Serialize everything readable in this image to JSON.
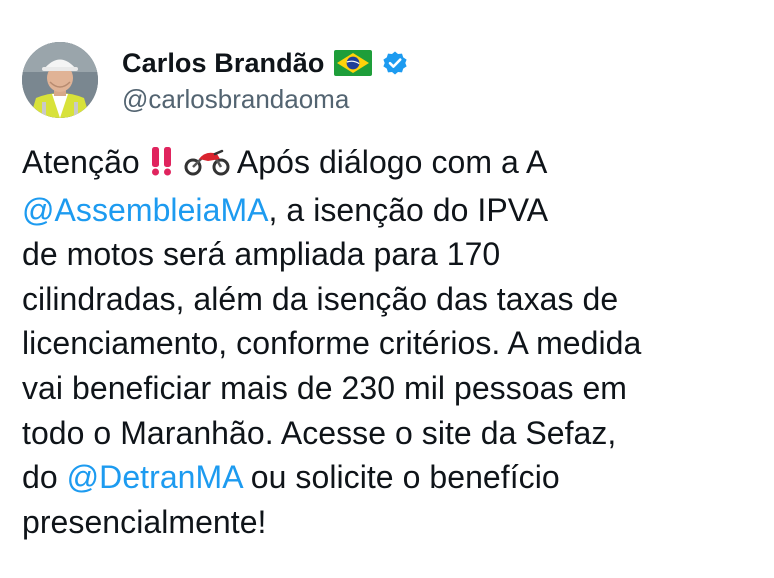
{
  "author": {
    "display_name": "Carlos Brandão",
    "handle": "@carlosbrandaoma",
    "flag_icon": "brazil-flag-icon",
    "verified_icon": "verified-badge-icon",
    "verified_color": "#1d9bf0"
  },
  "tweet": {
    "line1_a": "Atenção",
    "line1_icons": [
      "double-exclamation-icon",
      "motorcycle-icon"
    ],
    "line1_b": "Após diálogo com a A",
    "mention_assembleia": "@AssembleiaMA",
    "line2_rest": ", a isenção do IPVA",
    "line3": "de motos será ampliada para 170",
    "line4": "cilindradas, além da isenção das taxas de",
    "line5": "licenciamento, conforme critérios. A medida",
    "line6": "vai beneficiar mais de 230 mil pessoas em",
    "line7": "todo o Maranhão. Acesse o site da Sefaz,",
    "line8_a": "do ",
    "mention_detran": "@DetranMA",
    "line8_b": " ou solicite o benefício",
    "line9": "presencialmente!"
  },
  "colors": {
    "text": "#0f1419",
    "secondary": "#536471",
    "link": "#1d9bf0",
    "exclamation": "#e0245e",
    "motorcycle": "#d9232e"
  }
}
